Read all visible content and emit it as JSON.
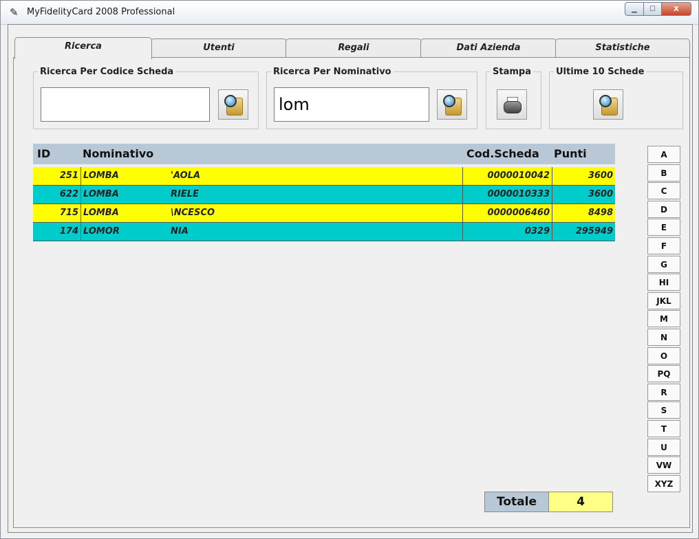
{
  "window": {
    "title": "MyFidelityCard 2008 Professional",
    "controls": {
      "minimize": "▁",
      "maximize": "☐",
      "close": "X"
    }
  },
  "tabs": [
    {
      "label": "Ricerca",
      "active": true
    },
    {
      "label": "Utenti"
    },
    {
      "label": "Regali"
    },
    {
      "label": "Dati Azienda"
    },
    {
      "label": "Statistiche"
    }
  ],
  "search": {
    "by_code": {
      "legend": "Ricerca Per Codice Scheda",
      "value": ""
    },
    "by_name": {
      "legend": "Ricerca Per Nominativo",
      "value": "lom"
    },
    "print": {
      "legend": "Stampa"
    },
    "last10": {
      "legend": "Ultime 10 Schede"
    }
  },
  "grid": {
    "columns": [
      "ID",
      "Nominativo",
      "Cod.Scheda",
      "Punti"
    ],
    "rows": [
      {
        "id": "251",
        "surname": "LOMBA",
        "name": "'AOLA",
        "card": "0000010042",
        "points": "3600"
      },
      {
        "id": "622",
        "surname": "LOMBA",
        "name": "RIELE",
        "card": "0000010333",
        "points": "3600"
      },
      {
        "id": "715",
        "surname": "LOMBA",
        "name": "\\NCESCO",
        "card": "0000006460",
        "points": "8498"
      },
      {
        "id": "174",
        "surname": "LOMOR",
        "name": "NIA",
        "card": "0329",
        "points": "295949"
      }
    ]
  },
  "letters": [
    "A",
    "B",
    "C",
    "D",
    "E",
    "F",
    "G",
    "HI",
    "JKL",
    "M",
    "N",
    "O",
    "PQ",
    "R",
    "S",
    "T",
    "U",
    "VW",
    "XYZ"
  ],
  "totals": {
    "label": "Totale",
    "value": "4"
  },
  "colors": {
    "row_yellow": "#ffff00",
    "row_teal": "#00cccc",
    "header_blue": "#b9c8d6",
    "total_yellow": "#ffff88"
  }
}
